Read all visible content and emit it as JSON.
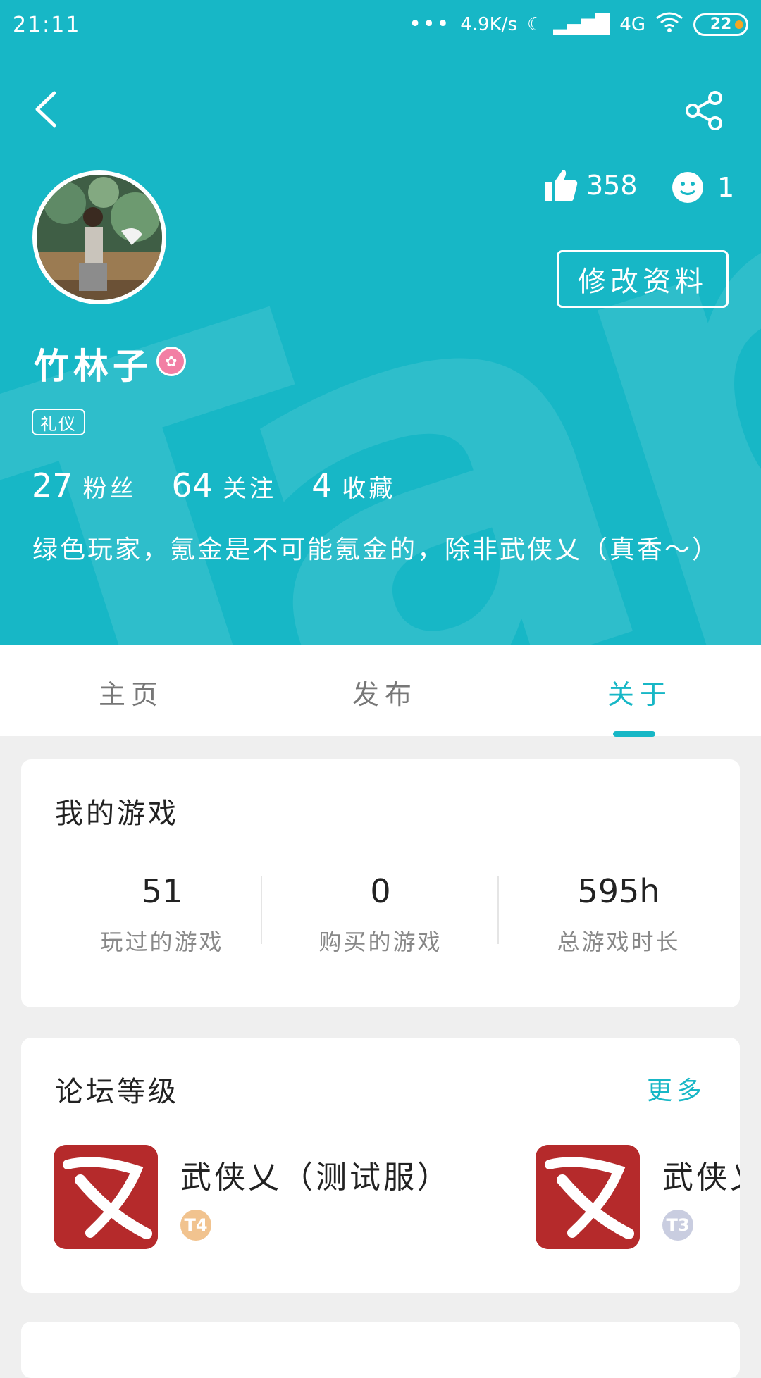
{
  "status_bar": {
    "time": "21:11",
    "net_speed": "4.9K/s",
    "signal": "4G",
    "battery": "22"
  },
  "profile": {
    "likes": "358",
    "faces": "1",
    "edit_label": "修改资料",
    "name": "竹林子",
    "tag": "礼仪",
    "stats": [
      {
        "num": "27",
        "label": "粉丝"
      },
      {
        "num": "64",
        "label": "关注"
      },
      {
        "num": "4",
        "label": "收藏"
      }
    ],
    "bio": "绿色玩家，氪金是不可能氪金的，除非武侠乂（真香～）"
  },
  "tabs": [
    {
      "label": "主页"
    },
    {
      "label": "发布"
    },
    {
      "label": "关于"
    }
  ],
  "my_games": {
    "title": "我的游戏",
    "metrics": [
      {
        "value": "51",
        "label": "玩过的游戏"
      },
      {
        "value": "0",
        "label": "购买的游戏"
      },
      {
        "value": "595h",
        "label": "总游戏时长"
      }
    ]
  },
  "forum_level": {
    "title": "论坛等级",
    "more": "更多",
    "items": [
      {
        "name": "武侠乂（测试服）",
        "level": "T4"
      },
      {
        "name": "武侠乂",
        "level": "T3"
      }
    ]
  },
  "colors": {
    "accent": "#17b7c6",
    "header_bg": "#17b7c6",
    "badge_pink": "#f27fa4"
  }
}
